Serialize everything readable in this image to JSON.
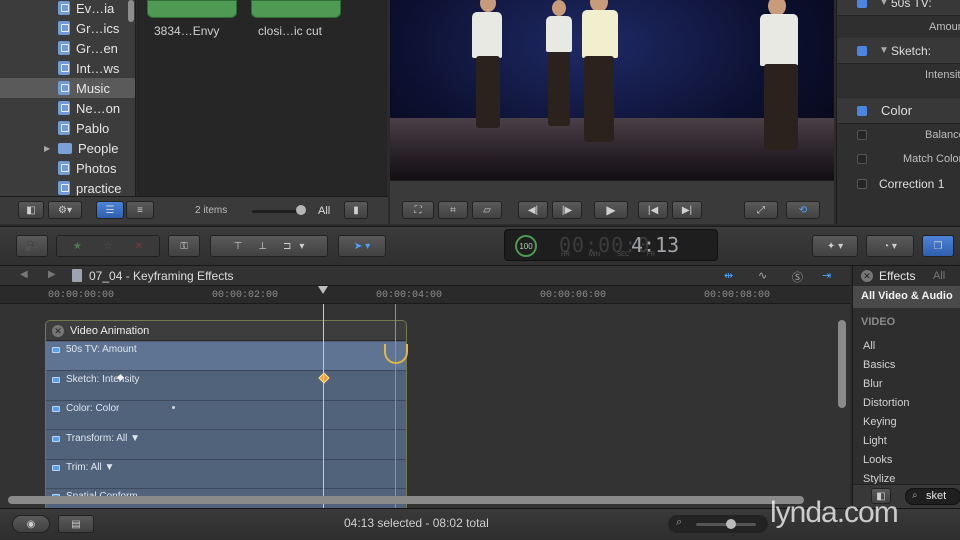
{
  "library": {
    "items": [
      {
        "label": "Ev…ia",
        "icon": "event-icon"
      },
      {
        "label": "Gr…ics",
        "icon": "event-icon"
      },
      {
        "label": "Gr…en",
        "icon": "event-icon"
      },
      {
        "label": "Int…ws",
        "icon": "event-icon"
      },
      {
        "label": "Music",
        "icon": "event-icon",
        "selected": true
      },
      {
        "label": "Ne…on",
        "icon": "event-icon"
      },
      {
        "label": "Pablo",
        "icon": "event-icon"
      },
      {
        "label": "People",
        "icon": "folder-icon",
        "disclosure": true
      },
      {
        "label": "Photos",
        "icon": "event-icon"
      },
      {
        "label": "practice",
        "icon": "event-icon"
      }
    ]
  },
  "browser": {
    "clips": [
      {
        "label": "3834…Envy"
      },
      {
        "label": "closi…ic cut"
      }
    ],
    "item_count": "2 items",
    "filter": "All"
  },
  "inspector": {
    "rows": [
      {
        "label": "50s TV:",
        "kind": "header"
      },
      {
        "label": "Amount",
        "kind": "param"
      },
      {
        "label": "Sketch:",
        "kind": "header"
      },
      {
        "label": "Intensity",
        "kind": "param"
      },
      {
        "label": "Color",
        "kind": "header"
      },
      {
        "label": "Balance",
        "kind": "param"
      },
      {
        "label": "Match Color",
        "kind": "param"
      },
      {
        "label": "Correction 1",
        "kind": "header"
      }
    ]
  },
  "timecode": {
    "badge": "100",
    "dim": "00:00:0",
    "value": "4:13",
    "units": [
      "HR",
      "MIN",
      "SEC",
      "FR"
    ]
  },
  "timeline": {
    "project": "07_04 - Keyframing Effects",
    "ruler": [
      "00:00:00:00",
      "00:00:02:00",
      "00:00:04:00",
      "00:00:06:00",
      "00:00:08:00"
    ],
    "animation_title": "Video Animation",
    "rows": [
      {
        "label": "50s TV: Amount"
      },
      {
        "label": "Sketch: Intensity"
      },
      {
        "label": "Color: Color"
      },
      {
        "label": "Transform: All ▼"
      },
      {
        "label": "Trim: All ▼"
      },
      {
        "label": "Spatial Conform…"
      }
    ]
  },
  "effects": {
    "title": "Effects",
    "filter": "All",
    "category_selected": "All Video & Audio",
    "section": "VIDEO",
    "items": [
      "All",
      "Basics",
      "Blur",
      "Distortion",
      "Keying",
      "Light",
      "Looks",
      "Stylize"
    ],
    "search_value": "sket"
  },
  "status": {
    "selection": "04:13 selected - 08:02 total"
  },
  "watermark": "lynda.com"
}
